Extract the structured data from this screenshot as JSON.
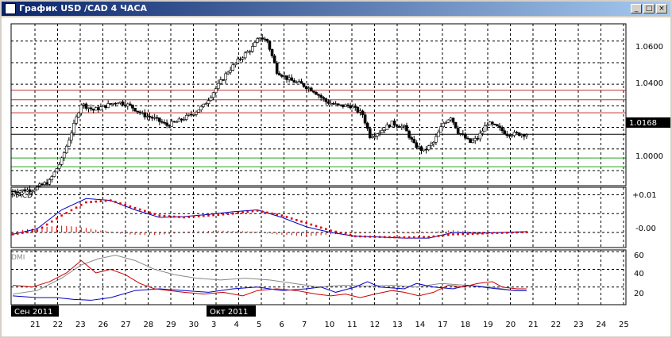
{
  "window": {
    "title": "График USD /CAD  4 ЧАСА",
    "buttons": {
      "minimize": "_",
      "maximize": "□",
      "close": "×"
    }
  },
  "price_scale": {
    "ticks": [
      "1.0600",
      "1.0400",
      "1.0000"
    ],
    "current_price": "1.0168"
  },
  "macd": {
    "label": "MACD",
    "ticks": [
      "+0.01",
      "-0.00"
    ]
  },
  "dmi": {
    "label": "DMI",
    "ticks": [
      "60",
      "40",
      "20"
    ]
  },
  "time_axis": {
    "days": [
      "21",
      "22",
      "23",
      "26",
      "27",
      "28",
      "29",
      "30",
      "3",
      "4",
      "5",
      "6",
      "7",
      "10",
      "11",
      "12",
      "13",
      "14",
      "17",
      "18",
      "19",
      "20",
      "21",
      "22",
      "23",
      "24",
      "25"
    ],
    "month_labels": [
      "Сен 2011",
      "Окт 2011"
    ]
  },
  "colors": {
    "background": "#ffffff",
    "grid": "#000000",
    "resistance_lines": "#c03030",
    "support_lines": "#20a020",
    "macd_signal": "#dd0000",
    "macd_line": "#0000cc",
    "dmi_adx": "#888888",
    "dmi_plus": "#0000cc",
    "dmi_minus": "#cc0000"
  },
  "chart_data": [
    {
      "type": "candlestick",
      "title": "",
      "ylim": [
        0.993,
        1.068
      ],
      "y_ticks": [
        1.06,
        1.04,
        1.0
      ],
      "horizontal_lines": [
        {
          "value": 1.0372,
          "color": "red"
        },
        {
          "value": 1.0328,
          "color": "red"
        },
        {
          "value": 1.0268,
          "color": "red"
        },
        {
          "value": 1.0168,
          "color": "black"
        },
        {
          "value": 1.0058,
          "color": "green"
        },
        {
          "value": 1.0018,
          "color": "green"
        }
      ],
      "current_price": 1.0168,
      "close_path": [
        [
          0,
          0.9905
        ],
        [
          8,
          0.9912
        ],
        [
          15,
          0.995
        ],
        [
          20,
          1.005
        ],
        [
          25,
          1.021
        ],
        [
          28,
          1.031
        ],
        [
          33,
          1.028
        ],
        [
          38,
          1.03
        ],
        [
          43,
          1.032
        ],
        [
          48,
          1.03
        ],
        [
          53,
          1.026
        ],
        [
          58,
          1.024
        ],
        [
          63,
          1.021
        ],
        [
          68,
          1.023
        ],
        [
          73,
          1.026
        ],
        [
          78,
          1.03
        ],
        [
          83,
          1.038
        ],
        [
          88,
          1.046
        ],
        [
          93,
          1.052
        ],
        [
          98,
          1.057
        ],
        [
          101,
          1.062
        ],
        [
          104,
          1.06
        ],
        [
          108,
          1.046
        ],
        [
          113,
          1.042
        ],
        [
          118,
          1.04
        ],
        [
          123,
          1.037
        ],
        [
          128,
          1.032
        ],
        [
          133,
          1.03
        ],
        [
          138,
          1.03
        ],
        [
          143,
          1.026
        ],
        [
          146,
          1.016
        ],
        [
          150,
          1.018
        ],
        [
          155,
          1.022
        ],
        [
          160,
          1.02
        ],
        [
          164,
          1.012
        ],
        [
          168,
          1.009
        ],
        [
          172,
          1.013
        ],
        [
          176,
          1.022
        ],
        [
          179,
          1.025
        ],
        [
          182,
          1.018
        ],
        [
          187,
          1.013
        ],
        [
          190,
          1.015
        ],
        [
          194,
          1.022
        ],
        [
          198,
          1.02
        ],
        [
          202,
          1.017
        ],
        [
          206,
          1.017
        ],
        [
          210,
          1.0168
        ]
      ]
    },
    {
      "type": "line",
      "title": "MACD",
      "ylim": [
        -0.004,
        0.012
      ],
      "y_ticks": [
        0.01,
        0.0
      ],
      "series": [
        {
          "name": "",
          "points": [
            [
              0,
              -0.0005
            ],
            [
              10,
              0.001
            ],
            [
              20,
              0.006
            ],
            [
              30,
              0.009
            ],
            [
              40,
              0.0085
            ],
            [
              50,
              0.006
            ],
            [
              60,
              0.004
            ],
            [
              70,
              0.0042
            ],
            [
              80,
              0.0048
            ],
            [
              90,
              0.0055
            ],
            [
              100,
              0.006
            ],
            [
              110,
              0.004
            ],
            [
              120,
              0.0015
            ],
            [
              130,
              0.0
            ],
            [
              140,
              -0.001
            ],
            [
              150,
              -0.0012
            ],
            [
              160,
              -0.0015
            ],
            [
              170,
              -0.0015
            ],
            [
              180,
              0.0
            ],
            [
              190,
              -0.0002
            ],
            [
              200,
              0.0
            ],
            [
              210,
              0.0002
            ]
          ]
        },
        {
          "name": "",
          "points": [
            [
              0,
              -0.0005
            ],
            [
              10,
              0.0005
            ],
            [
              20,
              0.0045
            ],
            [
              30,
              0.008
            ],
            [
              40,
              0.0085
            ],
            [
              50,
              0.0065
            ],
            [
              60,
              0.0045
            ],
            [
              70,
              0.004
            ],
            [
              80,
              0.0045
            ],
            [
              90,
              0.005
            ],
            [
              100,
              0.0058
            ],
            [
              110,
              0.0045
            ],
            [
              120,
              0.0025
            ],
            [
              130,
              0.0005
            ],
            [
              140,
              -0.001
            ],
            [
              150,
              -0.0012
            ],
            [
              160,
              -0.0013
            ],
            [
              170,
              -0.0012
            ],
            [
              180,
              -0.0005
            ],
            [
              190,
              -0.0003
            ],
            [
              200,
              -0.0001
            ],
            [
              210,
              0.0001
            ]
          ]
        }
      ],
      "histogram": [
        [
          0,
          0.0002
        ],
        [
          5,
          0.0008
        ],
        [
          10,
          0.0012
        ],
        [
          15,
          0.0016
        ],
        [
          20,
          0.0018
        ],
        [
          25,
          0.0016
        ],
        [
          30,
          0.0012
        ],
        [
          35,
          0.0006
        ],
        [
          40,
          0.0002
        ],
        [
          45,
          -0.0004
        ],
        [
          50,
          -0.0006
        ],
        [
          55,
          -0.0007
        ],
        [
          60,
          -0.0006
        ],
        [
          65,
          -0.0004
        ],
        [
          70,
          0.0002
        ],
        [
          75,
          0.0003
        ],
        [
          80,
          0.0004
        ],
        [
          85,
          0.0005
        ],
        [
          90,
          0.0004
        ],
        [
          95,
          0.0003
        ],
        [
          100,
          0.0002
        ],
        [
          105,
          -0.0004
        ],
        [
          110,
          -0.0006
        ],
        [
          115,
          -0.0008
        ],
        [
          120,
          -0.001
        ],
        [
          125,
          -0.0008
        ],
        [
          130,
          -0.0005
        ],
        [
          135,
          -0.0004
        ],
        [
          140,
          -0.0003
        ],
        [
          145,
          -0.0002
        ],
        [
          150,
          0.0001
        ],
        [
          155,
          -0.0002
        ],
        [
          160,
          -0.0002
        ],
        [
          165,
          -0.0003
        ],
        [
          170,
          -0.0001
        ],
        [
          175,
          0.0004
        ],
        [
          180,
          0.0006
        ],
        [
          185,
          0.0003
        ],
        [
          190,
          0.0002
        ],
        [
          195,
          0.0001
        ],
        [
          200,
          0.0001
        ],
        [
          205,
          0.0001
        ],
        [
          210,
          0.0001
        ]
      ]
    },
    {
      "type": "line",
      "title": "DMI",
      "ylim": [
        0,
        62
      ],
      "y_ticks": [
        60,
        40,
        20
      ],
      "series": [
        {
          "name": "",
          "color": "gray",
          "points": [
            [
              0,
              12
            ],
            [
              10,
              16
            ],
            [
              20,
              30
            ],
            [
              28,
              45
            ],
            [
              35,
              52
            ],
            [
              42,
              56
            ],
            [
              50,
              50
            ],
            [
              58,
              40
            ],
            [
              66,
              34
            ],
            [
              75,
              30
            ],
            [
              85,
              28
            ],
            [
              95,
              30
            ],
            [
              105,
              28
            ],
            [
              115,
              24
            ],
            [
              125,
              20
            ],
            [
              135,
              22
            ],
            [
              145,
              21
            ],
            [
              155,
              22
            ],
            [
              165,
              20
            ],
            [
              175,
              24
            ],
            [
              185,
              22
            ],
            [
              195,
              20
            ],
            [
              205,
              16
            ],
            [
              210,
              16
            ]
          ]
        },
        {
          "name": "",
          "color": "blue",
          "points": [
            [
              0,
              10
            ],
            [
              10,
              8
            ],
            [
              18,
              8
            ],
            [
              25,
              6
            ],
            [
              32,
              5
            ],
            [
              40,
              8
            ],
            [
              50,
              16
            ],
            [
              60,
              18
            ],
            [
              70,
              16
            ],
            [
              80,
              14
            ],
            [
              90,
              18
            ],
            [
              100,
              20
            ],
            [
              110,
              16
            ],
            [
              120,
              18
            ],
            [
              126,
              20
            ],
            [
              132,
              14
            ],
            [
              140,
              20
            ],
            [
              145,
              26
            ],
            [
              150,
              20
            ],
            [
              160,
              18
            ],
            [
              165,
              24
            ],
            [
              172,
              20
            ],
            [
              180,
              18
            ],
            [
              186,
              22
            ],
            [
              192,
              20
            ],
            [
              198,
              18
            ],
            [
              205,
              16
            ],
            [
              210,
              16
            ]
          ]
        },
        {
          "name": "",
          "color": "red",
          "points": [
            [
              0,
              22
            ],
            [
              8,
              20
            ],
            [
              15,
              26
            ],
            [
              22,
              36
            ],
            [
              28,
              50
            ],
            [
              34,
              36
            ],
            [
              40,
              40
            ],
            [
              46,
              34
            ],
            [
              52,
              24
            ],
            [
              58,
              18
            ],
            [
              64,
              16
            ],
            [
              70,
              14
            ],
            [
              78,
              12
            ],
            [
              86,
              14
            ],
            [
              94,
              10
            ],
            [
              100,
              16
            ],
            [
              108,
              18
            ],
            [
              116,
              16
            ],
            [
              124,
              12
            ],
            [
              130,
              10
            ],
            [
              136,
              12
            ],
            [
              142,
              8
            ],
            [
              148,
              12
            ],
            [
              155,
              16
            ],
            [
              160,
              14
            ],
            [
              166,
              10
            ],
            [
              172,
              14
            ],
            [
              178,
              22
            ],
            [
              184,
              20
            ],
            [
              190,
              24
            ],
            [
              196,
              26
            ],
            [
              200,
              20
            ],
            [
              206,
              18
            ],
            [
              210,
              18
            ]
          ]
        }
      ]
    }
  ]
}
